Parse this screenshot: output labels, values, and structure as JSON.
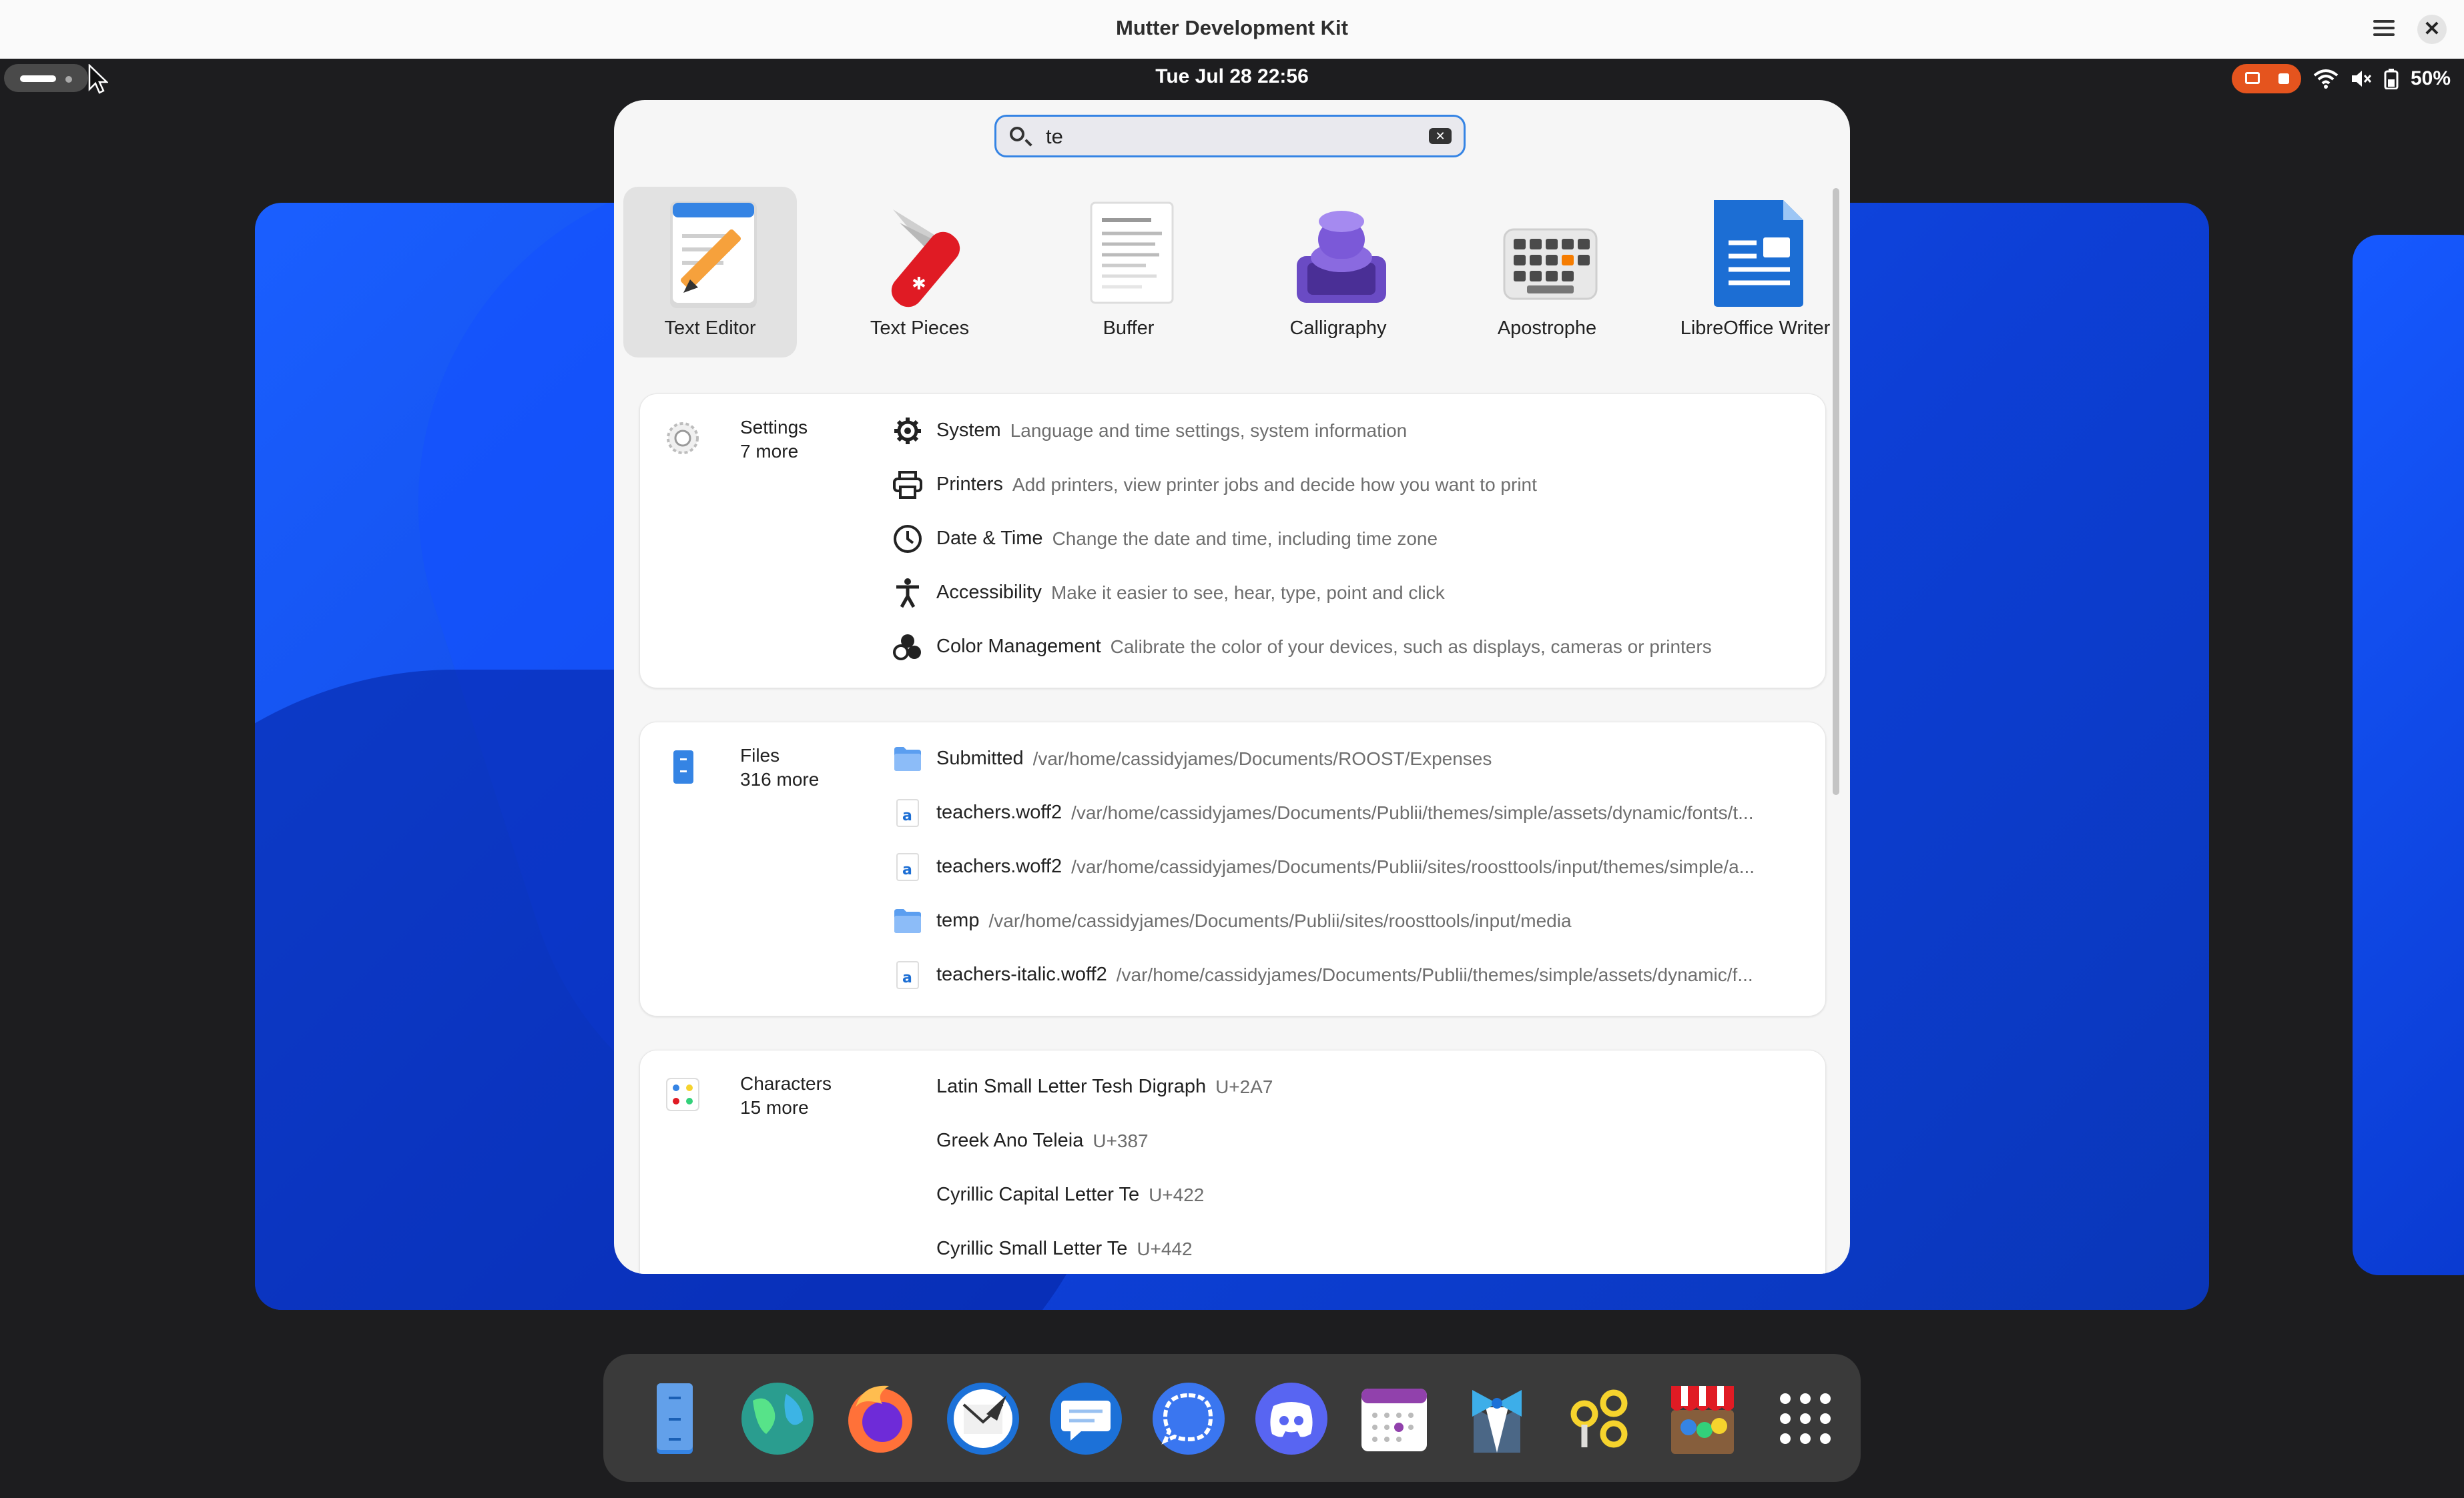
{
  "window": {
    "title": "Mutter Development Kit"
  },
  "topbar": {
    "clock": "Tue Jul 28  22:56",
    "battery": "50%"
  },
  "search": {
    "value": "te"
  },
  "apps": [
    {
      "label": "Text Editor",
      "selected": true
    },
    {
      "label": "Text Pieces"
    },
    {
      "label": "Buffer"
    },
    {
      "label": "Calligraphy"
    },
    {
      "label": "Apostrophe"
    },
    {
      "label": "LibreOffice Writer"
    }
  ],
  "settings": {
    "name": "Settings",
    "more": "7 more",
    "rows": [
      {
        "icon": "gear-icon",
        "title": "System",
        "desc": "Language and time settings, system information"
      },
      {
        "icon": "printer-icon",
        "title": "Printers",
        "desc": "Add printers, view printer jobs and decide how you want to print"
      },
      {
        "icon": "clock-icon",
        "title": "Date & Time",
        "desc": "Change the date and time, including time zone"
      },
      {
        "icon": "accessibility-icon",
        "title": "Accessibility",
        "desc": "Make it easier to see, hear, type, point and click"
      },
      {
        "icon": "color-management-icon",
        "title": "Color Management",
        "desc": "Calibrate the color of your devices, such as displays, cameras or printers"
      }
    ]
  },
  "files": {
    "name": "Files",
    "more": "316 more",
    "rows": [
      {
        "icon": "folder-icon",
        "title": "Submitted",
        "desc": "/var/home/cassidyjames/Documents/ROOST/Expenses"
      },
      {
        "icon": "font-file-icon",
        "title": "teachers.woff2",
        "desc": "/var/home/cassidyjames/Documents/Publii/themes/simple/assets/dynamic/fonts/t..."
      },
      {
        "icon": "font-file-icon",
        "title": "teachers.woff2",
        "desc": "/var/home/cassidyjames/Documents/Publii/sites/roosttools/input/themes/simple/a..."
      },
      {
        "icon": "folder-icon",
        "title": "temp",
        "desc": "/var/home/cassidyjames/Documents/Publii/sites/roosttools/input/media"
      },
      {
        "icon": "font-file-icon",
        "title": "teachers-italic.woff2",
        "desc": "/var/home/cassidyjames/Documents/Publii/themes/simple/assets/dynamic/f..."
      }
    ]
  },
  "characters": {
    "name": "Characters",
    "more": "15 more",
    "rows": [
      {
        "title": "Latin Small Letter Tesh Digraph",
        "desc": "U+2A7"
      },
      {
        "title": "Greek Ano Teleia",
        "desc": "U+387"
      },
      {
        "title": "Cyrillic Capital Letter Te",
        "desc": "U+422"
      },
      {
        "title": "Cyrillic Small Letter Te",
        "desc": "U+442"
      }
    ]
  },
  "dock": [
    "files-icon",
    "web-browser-icon",
    "firefox-icon",
    "mail-icon",
    "chat-icon",
    "signal-icon",
    "discord-icon",
    "calendar-icon",
    "tuxedo-icon",
    "gnome-builder-icon",
    "app-store-icon",
    "app-grid-icon"
  ]
}
